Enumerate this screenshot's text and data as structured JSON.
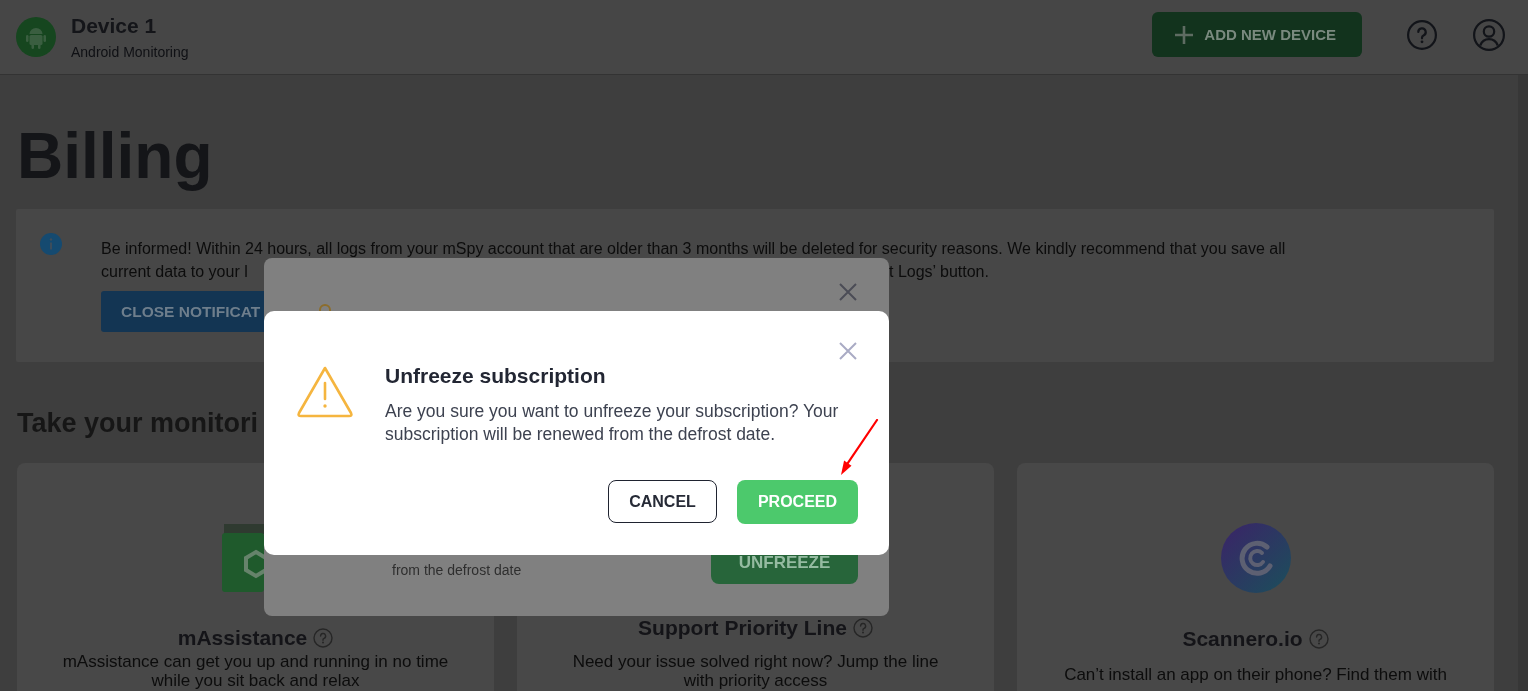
{
  "header": {
    "device_name": "Device 1",
    "device_type": "Android Monitoring",
    "add_button": "ADD NEW DEVICE"
  },
  "page_title": "Billing",
  "notification": {
    "lines": [
      {
        "fragments": [
          "Be informed! Within 24 hours, all logs from your mSpy account that are older than 3 months will be deleted for security reasons. We kindly recommend that you save all"
        ]
      },
      {
        "fragments": [
          "current data to your l",
          "t Logs’ button."
        ]
      }
    ],
    "button": "CLOSE NOTIFICAT"
  },
  "section_title": "Take your monitori",
  "cards": [
    {
      "kind": "package",
      "title": "mAssistance",
      "description": "mAssistance can get you up and running in no time while you sit back and relax"
    },
    {
      "kind": "plain",
      "title": "Support Priority Line",
      "description": "Need your issue solved right now? Jump the line with priority access"
    },
    {
      "kind": "logo",
      "title": "Scannero.io",
      "description": "Can’t install an app on their phone? Find them with"
    }
  ],
  "frozen_dialog": {
    "note": "from the defrost date",
    "button": "UNFREEZE"
  },
  "unfreeze_dialog": {
    "title": "Unfreeze subscription",
    "message": "Are you sure you want to unfreeze your subscription? Your subscription will be renewed from the defrost date.",
    "buttons": [
      {
        "kind": "secondary",
        "label": "CANCEL"
      },
      {
        "kind": "primary",
        "label": "PROCEED"
      }
    ]
  }
}
